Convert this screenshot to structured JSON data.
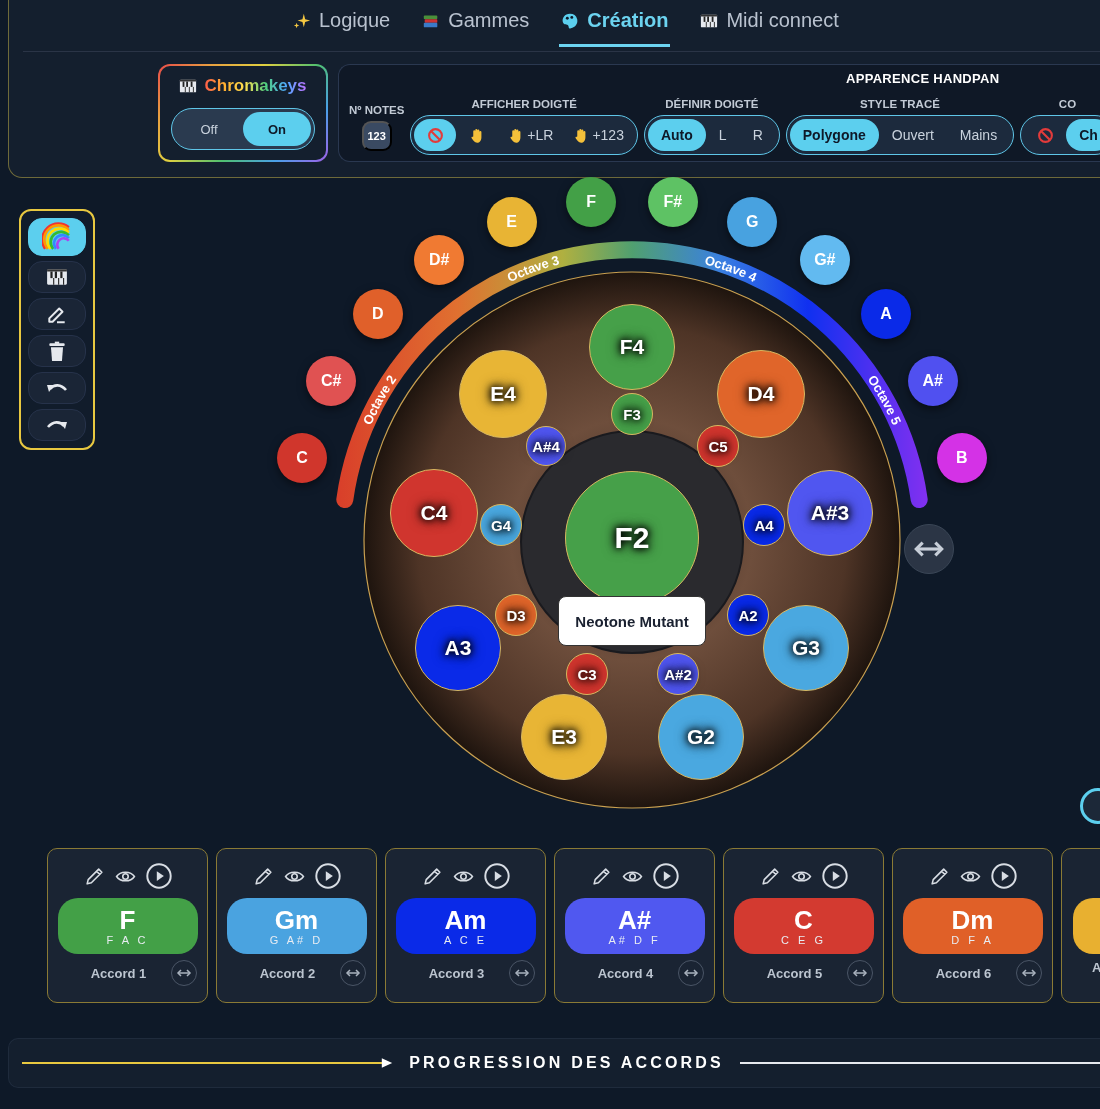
{
  "tabs": [
    {
      "label": "Logique",
      "selected": false
    },
    {
      "label": "Gammes",
      "selected": false
    },
    {
      "label": "Création",
      "selected": true
    },
    {
      "label": "Midi connect",
      "selected": false
    }
  ],
  "chromakeys": {
    "title": "Chromakeys",
    "options": [
      {
        "label": "Off",
        "selected": false
      },
      {
        "label": "On",
        "selected": true
      }
    ]
  },
  "settings": {
    "title": "APPARENCE HANDPAN",
    "groups": [
      {
        "label": "Nº NOTES",
        "kind": "badge",
        "value": "123"
      },
      {
        "label": "AFFICHER DOIGTÉ",
        "kind": "segmented",
        "options": [
          {
            "kind": "none",
            "selected": true
          },
          {
            "kind": "hand",
            "selected": false
          },
          {
            "kind": "hand",
            "label": "+LR",
            "selected": false
          },
          {
            "kind": "hand",
            "label": "+123",
            "selected": false
          }
        ]
      },
      {
        "label": "DÉFINIR DOIGTÉ",
        "kind": "segmented",
        "options": [
          {
            "kind": "text",
            "label": "Auto",
            "selected": true
          },
          {
            "kind": "text",
            "label": "L",
            "selected": false
          },
          {
            "kind": "text",
            "label": "R",
            "selected": false
          }
        ]
      },
      {
        "label": "STYLE TRACÉ",
        "kind": "segmented",
        "options": [
          {
            "kind": "text",
            "label": "Polygone",
            "selected": true
          },
          {
            "kind": "text",
            "label": "Ouvert",
            "selected": false
          },
          {
            "kind": "text",
            "label": "Mains",
            "selected": false
          }
        ]
      },
      {
        "label": "CO",
        "kind": "segmented",
        "options": [
          {
            "kind": "none",
            "selected": false
          },
          {
            "kind": "text",
            "label": "Ch",
            "selected": true
          }
        ]
      }
    ]
  },
  "toolbar": [
    {
      "kind": "rainbow",
      "selected": true
    },
    {
      "kind": "piano",
      "selected": false
    },
    {
      "kind": "eraser",
      "selected": false
    },
    {
      "kind": "trash",
      "selected": false
    },
    {
      "kind": "undo",
      "selected": false
    },
    {
      "kind": "redo",
      "selected": false
    }
  ],
  "handpan": {
    "model": "Neotone Mutant",
    "octaves": [
      "Octave 2",
      "Octave 3",
      "Octave 4",
      "Octave 5"
    ],
    "scale_notes": [
      {
        "label": "C",
        "color": "#d0362c"
      },
      {
        "label": "C#",
        "color": "#e05252"
      },
      {
        "label": "D",
        "color": "#e0602a"
      },
      {
        "label": "D#",
        "color": "#f07a32"
      },
      {
        "label": "E",
        "color": "#e8b434"
      },
      {
        "label": "F",
        "color": "#43a047"
      },
      {
        "label": "F#",
        "color": "#5ec264"
      },
      {
        "label": "G",
        "color": "#48a2e0"
      },
      {
        "label": "G#",
        "color": "#62baf0"
      },
      {
        "label": "A",
        "color": "#0a2ae8"
      },
      {
        "label": "A#",
        "color": "#5050f0"
      },
      {
        "label": "B",
        "color": "#d432e6"
      }
    ],
    "notes": [
      {
        "label": "F4",
        "color": "#46a049"
      },
      {
        "label": "E4",
        "color": "#e8b535"
      },
      {
        "label": "D4",
        "color": "#e0652a"
      },
      {
        "label": "F3",
        "color": "#46a049"
      },
      {
        "label": "A#4",
        "color": "#5056f0"
      },
      {
        "label": "C5",
        "color": "#d0352e"
      },
      {
        "label": "C4",
        "color": "#d0352e"
      },
      {
        "label": "G4",
        "color": "#4aa8e0"
      },
      {
        "label": "F2",
        "color": "#46a049"
      },
      {
        "label": "A4",
        "color": "#0a2ae8"
      },
      {
        "label": "A#3",
        "color": "#5056f0"
      },
      {
        "label": "D3",
        "color": "#e0652a"
      },
      {
        "label": "A3",
        "color": "#0a2ae8"
      },
      {
        "label": "A2",
        "color": "#0a2ae8"
      },
      {
        "label": "G3",
        "color": "#4aa8e0"
      },
      {
        "label": "C3",
        "color": "#d0352e"
      },
      {
        "label": "A#2",
        "color": "#5056f0"
      },
      {
        "label": "E3",
        "color": "#e8b535"
      },
      {
        "label": "G2",
        "color": "#4aa8e0"
      }
    ]
  },
  "chords": [
    {
      "name": "F",
      "notes": "F A C",
      "label": "Accord 1",
      "color": "#43a047"
    },
    {
      "name": "Gm",
      "notes": "G A# D",
      "label": "Accord 2",
      "color": "#4aa3e0"
    },
    {
      "name": "Am",
      "notes": "A C E",
      "label": "Accord 3",
      "color": "#0a2ae8"
    },
    {
      "name": "A#",
      "notes": "A# D F",
      "label": "Accord 4",
      "color": "#5058f0"
    },
    {
      "name": "C",
      "notes": "C E G",
      "label": "Accord 5",
      "color": "#d33a30"
    },
    {
      "name": "Dm",
      "notes": "D F A",
      "label": "Accord 6",
      "color": "#e06028"
    },
    {
      "label": "A",
      "color": "#e8b030"
    }
  ],
  "progression": {
    "title": "PROGRESSION DES ACCORDS"
  }
}
